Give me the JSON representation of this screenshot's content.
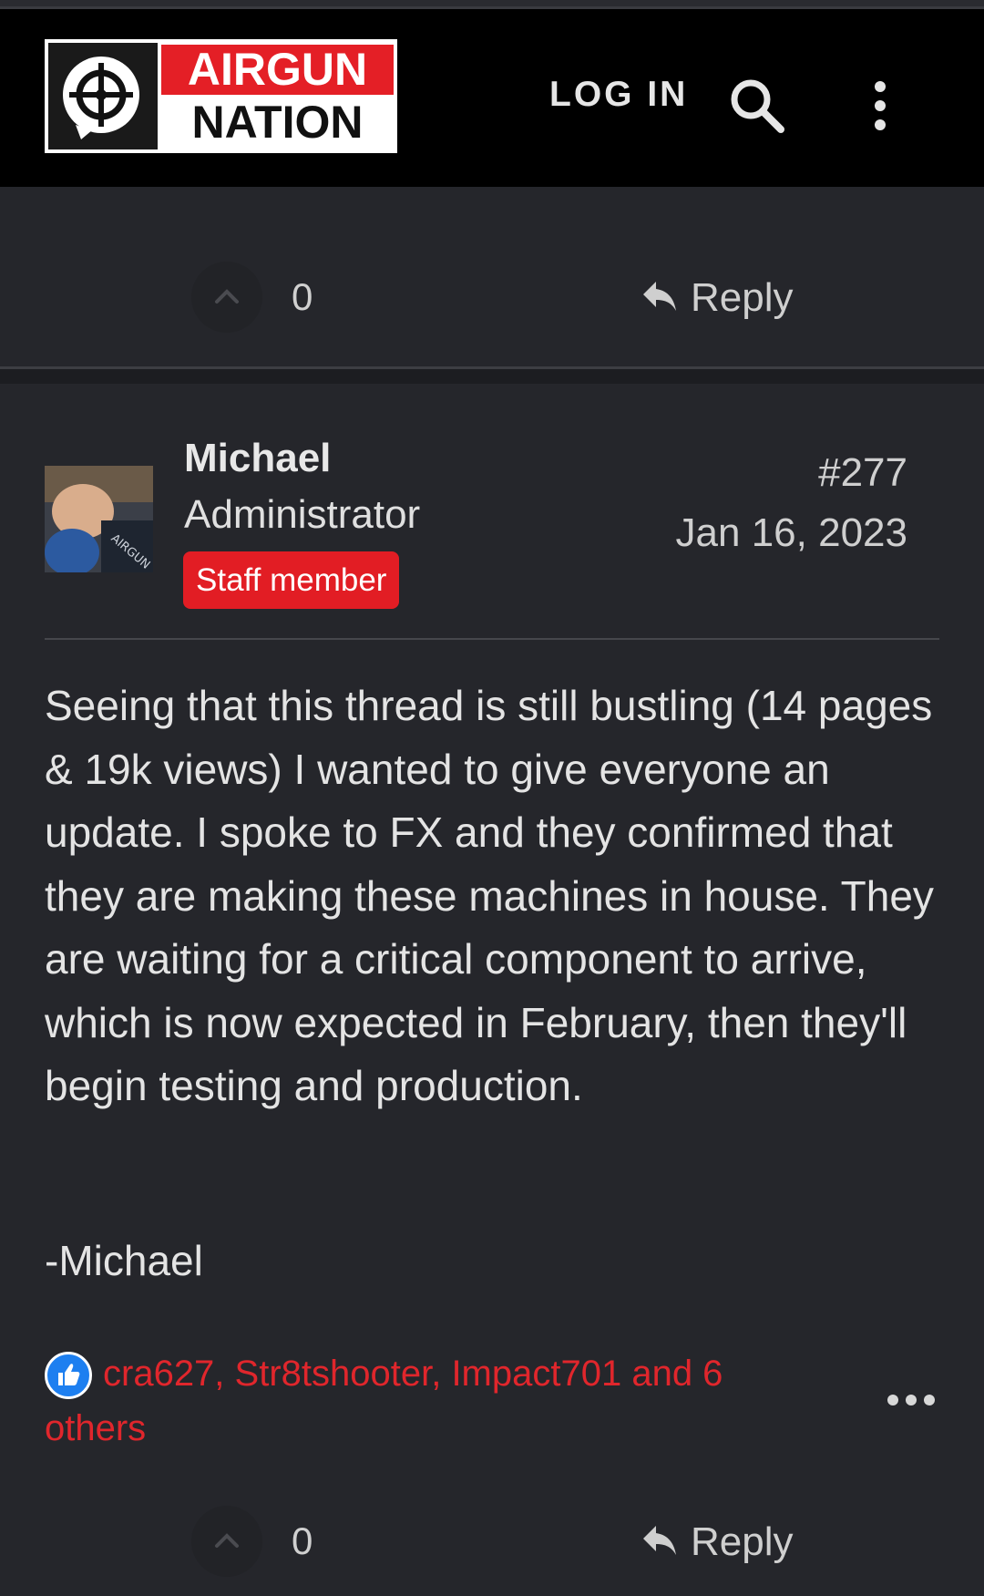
{
  "header": {
    "logo_line1": "AIRGUN",
    "logo_line2": "NATION",
    "login_label": "LOG IN",
    "search_icon": "search-icon",
    "menu_icon": "more-vertical-icon"
  },
  "prev_post": {
    "vote_count": "0",
    "reply_label": "Reply"
  },
  "post": {
    "author": "Michael",
    "role": "Administrator",
    "badge": "Staff member",
    "number": "#277",
    "date": "Jan 16, 2023",
    "body": "Seeing that this thread is still bustling (14 pages & 19k views) I wanted to give everyone an update. I spoke to FX and they confirmed that they are making these machines in house. They are waiting for a critical component to arrive, which is now expected in February, then they'll begin testing and production.",
    "signature": "-Michael",
    "reactions": "cra627, Str8tshooter, Impact701 and 6 others",
    "vote_count": "0",
    "reply_label": "Reply"
  },
  "colors": {
    "accent_red": "#e21d24",
    "like_blue": "#1d7ff0",
    "background": "#25262b"
  }
}
